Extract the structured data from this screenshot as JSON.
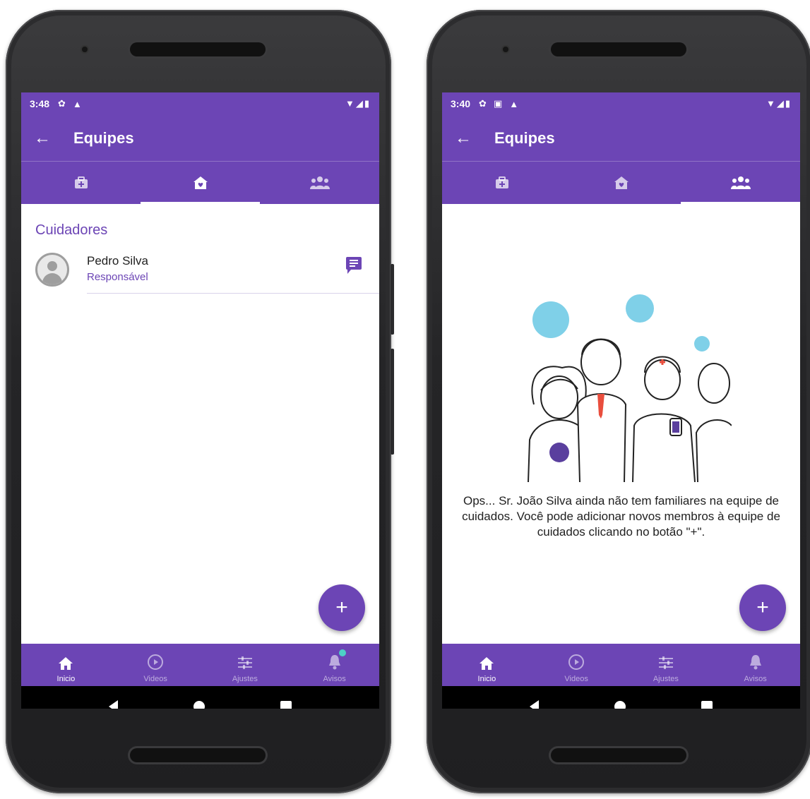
{
  "left": {
    "status": {
      "time": "3:48",
      "icons": [
        "gear-icon",
        "alert-icon"
      ],
      "right": "▼◢▮"
    },
    "app_bar": {
      "back": "←",
      "title": "Equipes"
    },
    "tabs": [
      {
        "icon": "medical-kit-icon",
        "glyph": "⊞",
        "active": false
      },
      {
        "icon": "home-heart-icon",
        "glyph": "⌂",
        "active": true
      },
      {
        "icon": "group-icon",
        "glyph": "👥",
        "active": false
      }
    ],
    "section_title": "Cuidadores",
    "members": [
      {
        "name": "Pedro Silva",
        "role": "Responsável"
      }
    ],
    "fab": "+"
  },
  "right": {
    "status": {
      "time": "3:40",
      "icons": [
        "gear-icon",
        "screenshot-icon",
        "alert-icon"
      ],
      "right": "▼◢▮"
    },
    "app_bar": {
      "back": "←",
      "title": "Equipes"
    },
    "tabs": [
      {
        "icon": "medical-kit-icon",
        "glyph": "⊞",
        "active": false
      },
      {
        "icon": "home-heart-icon",
        "glyph": "⌂",
        "active": false
      },
      {
        "icon": "group-icon",
        "glyph": "👥",
        "active": true
      }
    ],
    "empty_message": "Ops... Sr.  João Silva ainda não tem familiares na equipe de cuidados. Você pode adicionar novos membros à equipe de cuidados clicando no botão \"+\".",
    "fab": "+"
  },
  "bottom_nav": [
    {
      "label": "Inicio",
      "icon": "home-icon",
      "glyph": "⌂"
    },
    {
      "label": "Videos",
      "icon": "play-circle-icon",
      "glyph": "▷"
    },
    {
      "label": "Ajustes",
      "icon": "sliders-icon",
      "glyph": "☰"
    },
    {
      "label": "Avisos",
      "icon": "bell-icon",
      "glyph": "🔔"
    }
  ],
  "colors": {
    "primary": "#6c45b5",
    "badge": "#4dd0c6",
    "bubble": "#7fd0e8"
  }
}
